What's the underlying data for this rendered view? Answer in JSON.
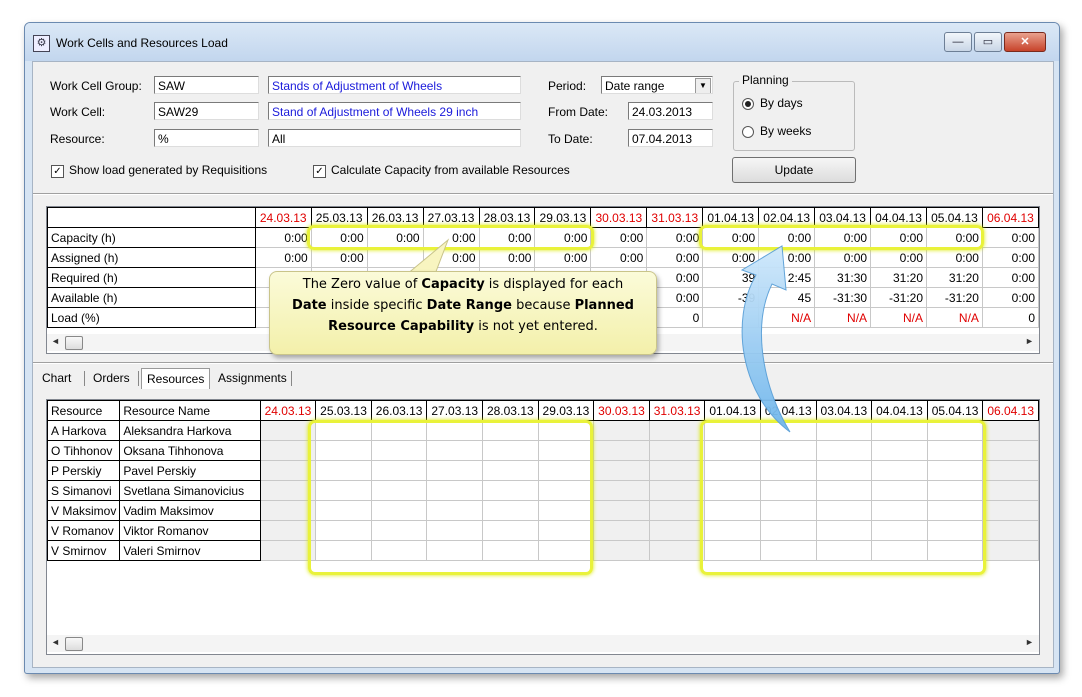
{
  "window": {
    "title": "Work Cells and Resources Load",
    "controls": {
      "minimize": "—",
      "maximize": "▭",
      "close": "✕"
    }
  },
  "form": {
    "work_cell_group_label": "Work Cell Group:",
    "work_cell_group_value": "SAW",
    "work_cell_group_desc": "Stands of Adjustment of Wheels",
    "work_cell_label": "Work Cell:",
    "work_cell_value": "SAW29",
    "work_cell_desc": "Stand of Adjustment of Wheels 29 inch",
    "resource_label": "Resource:",
    "resource_value": "%",
    "resource_desc": "All",
    "period_label": "Period:",
    "period_value": "Date range",
    "from_date_label": "From Date:",
    "from_date_value": "24.03.2013",
    "to_date_label": "To Date:",
    "to_date_value": "07.04.2013",
    "planning_label": "Planning",
    "by_days_label": "By days",
    "by_weeks_label": "By weeks",
    "update_label": "Update",
    "show_load_label": "Show load generated by Requisitions",
    "calc_capacity_label": "Calculate Capacity from available Resources"
  },
  "load_grid": {
    "dates": [
      {
        "label": "24.03.13",
        "weekend": true
      },
      {
        "label": "25.03.13",
        "weekend": false
      },
      {
        "label": "26.03.13",
        "weekend": false
      },
      {
        "label": "27.03.13",
        "weekend": false
      },
      {
        "label": "28.03.13",
        "weekend": false
      },
      {
        "label": "29.03.13",
        "weekend": false
      },
      {
        "label": "30.03.13",
        "weekend": true
      },
      {
        "label": "31.03.13",
        "weekend": true
      },
      {
        "label": "01.04.13",
        "weekend": false
      },
      {
        "label": "02.04.13",
        "weekend": false
      },
      {
        "label": "03.04.13",
        "weekend": false
      },
      {
        "label": "04.04.13",
        "weekend": false
      },
      {
        "label": "05.04.13",
        "weekend": false
      },
      {
        "label": "06.04.13",
        "weekend": true
      }
    ],
    "rows": [
      {
        "label": "Capacity (h)",
        "cells": [
          "0:00",
          "0:00",
          "0:00",
          "0:00",
          "0:00",
          "0:00",
          "0:00",
          "0:00",
          "0:00",
          "0:00",
          "0:00",
          "0:00",
          "0:00",
          "0:00"
        ]
      },
      {
        "label": "Assigned (h)",
        "cells": [
          "0:00",
          "0:00",
          "",
          "0:00",
          "0:00",
          "0:00",
          "0:00",
          "0:00",
          "0:00",
          "0:00",
          "0:00",
          "0:00",
          "0:00",
          "0:00"
        ]
      },
      {
        "label": "Required (h)",
        "cells": [
          "",
          "",
          "",
          "",
          "",
          "",
          "",
          "0:00",
          "39",
          "2:45",
          "31:30",
          "31:20",
          "31:20",
          "0:00"
        ]
      },
      {
        "label": "Available (h)",
        "cells": [
          "",
          "",
          "",
          "",
          "",
          "",
          "",
          "0:00",
          "-39",
          "45",
          "-31:30",
          "-31:20",
          "-31:20",
          "0:00"
        ]
      },
      {
        "label": "Load (%)",
        "cells": [
          "",
          "",
          "",
          "",
          "",
          "",
          "",
          "0",
          "",
          "N/A",
          "N/A",
          "N/A",
          "N/A",
          "0"
        ]
      }
    ]
  },
  "callout": {
    "t1": "The Zero value of ",
    "b1": "Capacity",
    "t2": " is displayed for each",
    "b2": "Date",
    "t3": " inside specific ",
    "b3": "Date Range",
    "t4": " because ",
    "b4": "Planned",
    "b5": "Resource Capability",
    "t5": " is not yet entered."
  },
  "tabs": [
    "Chart",
    "Orders",
    "Resources",
    "Assignments"
  ],
  "active_tab": "Resources",
  "resources_grid": {
    "header_resource": "Resource",
    "header_name": "Resource Name",
    "dates": [
      "24.03.13",
      "25.03.13",
      "26.03.13",
      "27.03.13",
      "28.03.13",
      "29.03.13",
      "30.03.13",
      "31.03.13",
      "01.04.13",
      "02.04.13",
      "03.04.13",
      "04.04.13",
      "05.04.13",
      "06.04.13"
    ],
    "rows": [
      {
        "code": "A Harkova",
        "name": "Aleksandra Harkova"
      },
      {
        "code": "O Tihhonov",
        "name": "Oksana Tihhonova"
      },
      {
        "code": "P Perskiy",
        "name": "Pavel Perskiy"
      },
      {
        "code": "S Simanovi",
        "name": "Svetlana Simanovicius"
      },
      {
        "code": "V Maksimov",
        "name": "Vadim Maksimov"
      },
      {
        "code": "V Romanov",
        "name": "Viktor Romanov"
      },
      {
        "code": "V Smirnov",
        "name": "Valeri Smirnov"
      }
    ]
  },
  "colors": {
    "weekend": "#e00000",
    "na": "#e00000",
    "highlight": "#e9f23a",
    "arrow": "#8ec8f0"
  }
}
